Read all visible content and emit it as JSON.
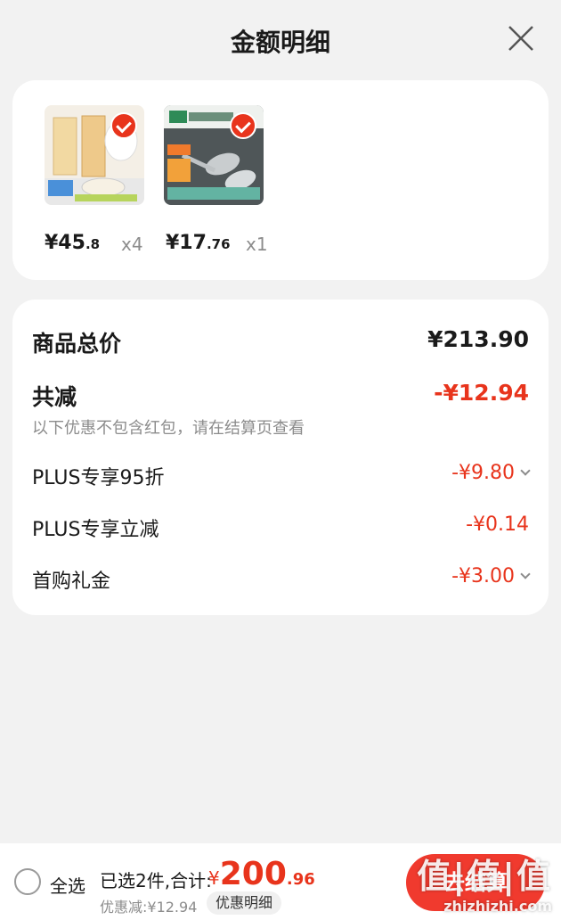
{
  "header": {
    "title": "金额明细",
    "close_icon": "close-icon"
  },
  "products": [
    {
      "price_int": "¥45",
      "price_dec": ".8",
      "qty": "x4",
      "thumb": "storage-jar-product-image"
    },
    {
      "price_int": "¥17",
      "price_dec": ".76",
      "qty": "x1",
      "thumb": "spoon-product-image"
    }
  ],
  "summary": {
    "total_label": "商品总价",
    "total_value": "¥213.90",
    "reduce_label": "共减",
    "reduce_value": "-¥12.94",
    "reduce_note": "以下优惠不包含红包，请在结算页查看",
    "items": [
      {
        "label": "PLUS专享95折",
        "value": "-¥9.80",
        "expandable": true
      },
      {
        "label": "PLUS专享立减",
        "value": "-¥0.14",
        "expandable": false
      },
      {
        "label": "首购礼金",
        "value": "-¥3.00",
        "expandable": true
      }
    ]
  },
  "footer": {
    "select_all": "全选",
    "selected_count": "已选2件,合计:",
    "total_symbol": "¥",
    "total_int": "200",
    "total_dec": ".96",
    "discount": "优惠减:¥12.94",
    "detail_button": "优惠明细",
    "checkout_button": "去结算"
  },
  "watermark": {
    "big": "值|值|值",
    "small": "zhizhizhi.com"
  },
  "colors": {
    "accent": "#e8341c",
    "background": "#f2f2f2",
    "card": "#ffffff"
  }
}
